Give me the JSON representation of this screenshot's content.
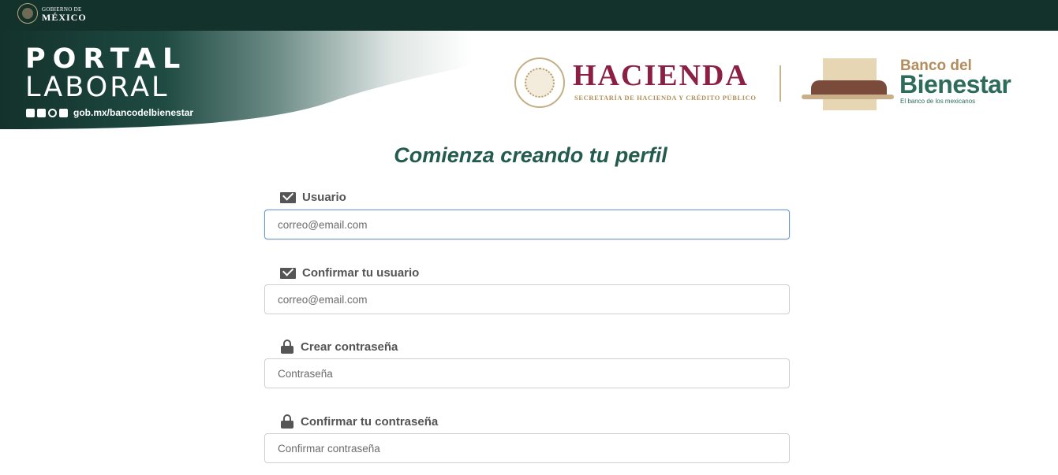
{
  "gov_header": {
    "line1": "GOBIERNO DE",
    "line2": "MÉXICO"
  },
  "banner": {
    "title_line1": "PORTAL",
    "title_line2": "LABORAL",
    "social_icons": [
      "facebook-icon",
      "twitter-icon",
      "instagram-icon",
      "youtube-icon"
    ],
    "social_url": "gob.mx/bancodelbienestar",
    "hacienda_name": "HACIENDA",
    "hacienda_sub": "SECRETARÍA DE HACIENDA Y CRÉDITO PÚBLICO",
    "bienestar_small": "Banco del",
    "bienestar_big": "Bienestar",
    "bienestar_tag": "El banco de los mexicanos",
    "colors": {
      "dark_green": "#13322b",
      "guinda": "#8b2044",
      "gold": "#b38e5d",
      "green": "#2d6c5a"
    }
  },
  "form": {
    "title": "Comienza creando tu perfil",
    "fields": [
      {
        "label": "Usuario",
        "icon": "envelope-icon",
        "placeholder": "correo@email.com",
        "focused": true
      },
      {
        "label": "Confirmar tu usuario",
        "icon": "envelope-icon",
        "placeholder": "correo@email.com",
        "focused": false
      },
      {
        "label": "Crear contraseña",
        "icon": "lock-icon",
        "placeholder": "Contraseña",
        "focused": false
      },
      {
        "label": "Confirmar tu contraseña",
        "icon": "lock-icon",
        "placeholder": "Confirmar contraseña",
        "focused": false
      }
    ]
  }
}
